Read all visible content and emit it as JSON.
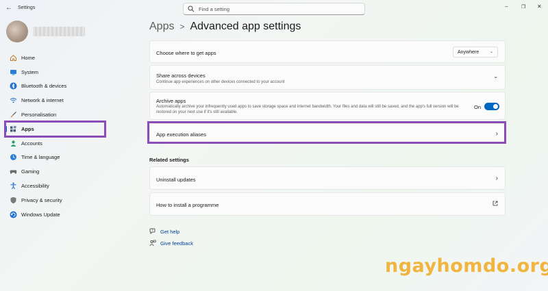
{
  "window": {
    "title": "Settings",
    "back_icon": "back-arrow-icon"
  },
  "search": {
    "placeholder": "Find a setting"
  },
  "profile": {
    "name": ""
  },
  "sidebar": {
    "items": [
      {
        "label": "Home",
        "icon": "home-icon"
      },
      {
        "label": "System",
        "icon": "system-icon"
      },
      {
        "label": "Bluetooth & devices",
        "icon": "bluetooth-icon"
      },
      {
        "label": "Network & internet",
        "icon": "wifi-icon"
      },
      {
        "label": "Personalisation",
        "icon": "brush-icon"
      },
      {
        "label": "Apps",
        "icon": "apps-icon",
        "active": true
      },
      {
        "label": "Accounts",
        "icon": "accounts-icon"
      },
      {
        "label": "Time & language",
        "icon": "time-language-icon"
      },
      {
        "label": "Gaming",
        "icon": "gaming-icon"
      },
      {
        "label": "Accessibility",
        "icon": "accessibility-icon"
      },
      {
        "label": "Privacy & security",
        "icon": "shield-icon"
      },
      {
        "label": "Windows Update",
        "icon": "windows-update-icon"
      }
    ]
  },
  "header": {
    "breadcrumb_parent": "Apps",
    "separator": ">",
    "title": "Advanced app settings"
  },
  "settings": {
    "where_to_get": {
      "title": "Choose where to get apps",
      "value": "Anywhere"
    },
    "share": {
      "title": "Share across devices",
      "subtitle": "Continue app experiences on other devices connected to your account"
    },
    "archive": {
      "title": "Archive apps",
      "subtitle": "Automatically archive your infrequently used apps to save storage space and internet bandwidth. Your files and data will still be saved, and the app's full version will be restored on your next use if it's still available.",
      "toggle_label": "On",
      "toggle_on": true
    },
    "execution_aliases": {
      "title": "App execution aliases"
    }
  },
  "related": {
    "heading": "Related settings",
    "uninstall_updates": "Uninstall updates",
    "install_programme": "How to install a programme"
  },
  "help": {
    "get_help": "Get help",
    "give_feedback": "Give feedback"
  },
  "watermark": {
    "text": "ngayhomdo.org"
  },
  "colors": {
    "accent": "#0067c0",
    "highlight": "#8a4cb8",
    "watermark": "#f0b53e"
  }
}
